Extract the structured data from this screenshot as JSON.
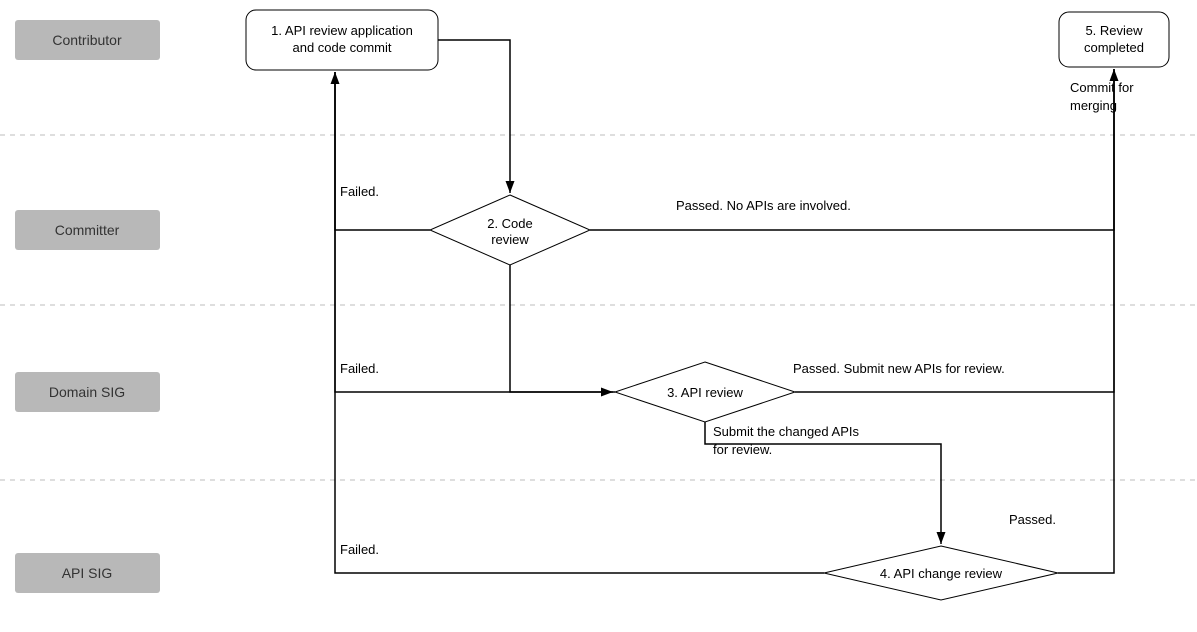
{
  "lanes": {
    "contributor": "Contributor",
    "committer": "Committer",
    "domain_sig": "Domain SIG",
    "api_sig": "API SIG"
  },
  "nodes": {
    "step1_line1": "1. API review application",
    "step1_line2": "and code commit",
    "step2_line1": "2. Code",
    "step2_line2": "review",
    "step3": "3. API review",
    "step4": "4. API change review",
    "step5_line1": "5. Review",
    "step5_line2": "completed"
  },
  "edges": {
    "failed": "Failed.",
    "passed_no_apis": "Passed. No APIs are involved.",
    "passed_new_apis": "Passed. Submit new APIs for review.",
    "submit_changed_line1": "Submit the changed APIs",
    "submit_changed_line2": "for review.",
    "passed": "Passed.",
    "commit_merge_line1": "Commit for",
    "commit_merge_line2": "merging"
  }
}
